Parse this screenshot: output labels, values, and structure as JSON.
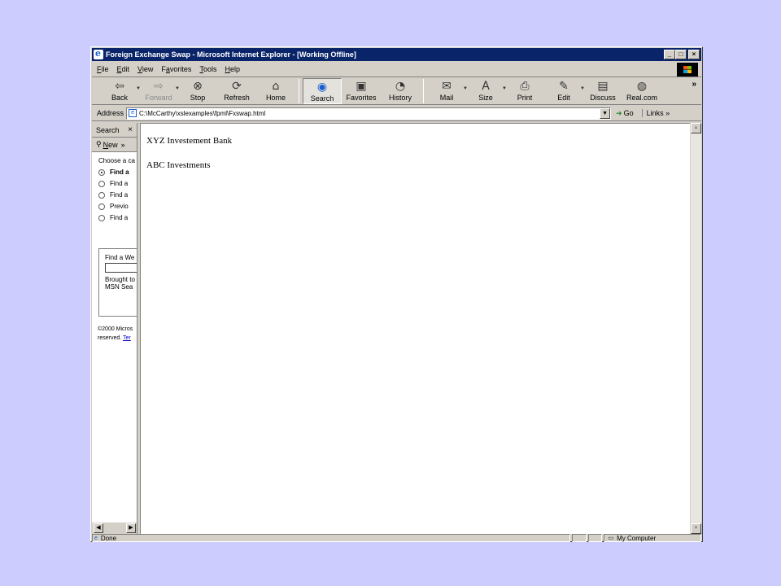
{
  "window": {
    "title": "Foreign Exchange Swap - Microsoft Internet Explorer - [Working Offline]",
    "controls": [
      "_",
      "□",
      "×"
    ]
  },
  "menu": [
    {
      "first": "F",
      "rest": "ile"
    },
    {
      "first": "E",
      "rest": "dit"
    },
    {
      "first": "V",
      "rest": "iew"
    },
    {
      "pre": "F",
      "first": "a",
      "rest": "vorites"
    },
    {
      "first": "T",
      "rest": "ools"
    },
    {
      "first": "H",
      "rest": "elp"
    }
  ],
  "toolbar": {
    "back": "Back",
    "forward": "Forward",
    "stop": "Stop",
    "refresh": "Refresh",
    "home": "Home",
    "search": "Search",
    "favorites": "Favorites",
    "history": "History",
    "mail": "Mail",
    "size": "Size",
    "print": "Print",
    "edit": "Edit",
    "discuss": "Discuss",
    "realcom": "Real.com",
    "more": "»"
  },
  "address": {
    "label": "Address",
    "value": "C:\\McCarthy\\xslexamples\\fpml\\Fxswap.html",
    "go": "Go",
    "links": "Links"
  },
  "search_pane": {
    "title": "Search",
    "close": "×",
    "new_first": "N",
    "new_rest": "ew",
    "more": "»",
    "prompt": "Choose a ca",
    "options": [
      "Find a",
      "Find a",
      "Find a",
      "Previo",
      "Find a"
    ],
    "box_title": "Find a We",
    "brought_by_1": "Brought to",
    "brought_by_2": "MSN Sea",
    "copyright_1": "©2000 Micros",
    "copyright_2": "reserved.",
    "terms": "Ter"
  },
  "content": {
    "line1": "XYZ Investement Bank",
    "line2": "ABC Investments"
  },
  "status": {
    "text": "Done",
    "zone": "My Computer"
  }
}
